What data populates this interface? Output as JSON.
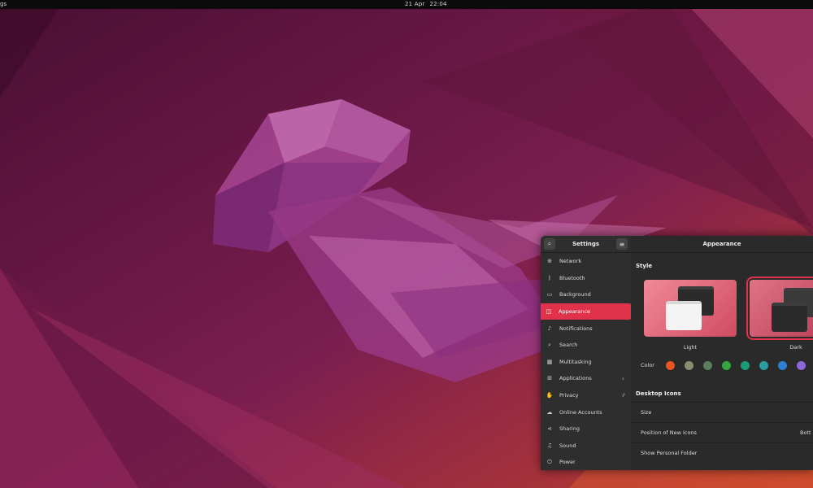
{
  "topbar": {
    "app_fragment": "gs",
    "date": "21 Apr",
    "time": "22:04"
  },
  "sidebar": {
    "title": "Settings",
    "items": [
      {
        "label": "Network",
        "icon": "network-icon",
        "glyph": "⊕"
      },
      {
        "label": "Bluetooth",
        "icon": "bluetooth-icon",
        "glyph": "ᛒ"
      },
      {
        "label": "Background",
        "icon": "background-icon",
        "glyph": "▭"
      },
      {
        "label": "Appearance",
        "icon": "appearance-icon",
        "glyph": "◫"
      },
      {
        "label": "Notifications",
        "icon": "bell-icon",
        "glyph": "♪"
      },
      {
        "label": "Search",
        "icon": "search-icon",
        "glyph": "⌕"
      },
      {
        "label": "Multitasking",
        "icon": "multitasking-icon",
        "glyph": "▦"
      },
      {
        "label": "Applications",
        "icon": "applications-icon",
        "glyph": "⊞"
      },
      {
        "label": "Privacy",
        "icon": "hand-icon",
        "glyph": "✋"
      },
      {
        "label": "Online Accounts",
        "icon": "cloud-icon",
        "glyph": "☁"
      },
      {
        "label": "Sharing",
        "icon": "share-icon",
        "glyph": "⋖"
      },
      {
        "label": "Sound",
        "icon": "music-icon",
        "glyph": "♫"
      },
      {
        "label": "Power",
        "icon": "power-icon",
        "glyph": "⏻"
      }
    ]
  },
  "main": {
    "title": "Appearance",
    "style_label": "Style",
    "themes": [
      {
        "label": "Light"
      },
      {
        "label": "Dark"
      }
    ],
    "color_label": "Color",
    "colors": [
      "#e95420",
      "#898e72",
      "#5b7f5c",
      "#37a640",
      "#1b9a7a",
      "#2a9d9e",
      "#2b7fd4",
      "#8d68d8"
    ],
    "desktop_icons_label": "Desktop Icons",
    "rows": [
      {
        "label": "Size",
        "value": ""
      },
      {
        "label": "Position of New Icons",
        "value": "Bott"
      },
      {
        "label": "Show Personal Folder",
        "value": ""
      }
    ]
  },
  "accent_color": "#e0324b"
}
